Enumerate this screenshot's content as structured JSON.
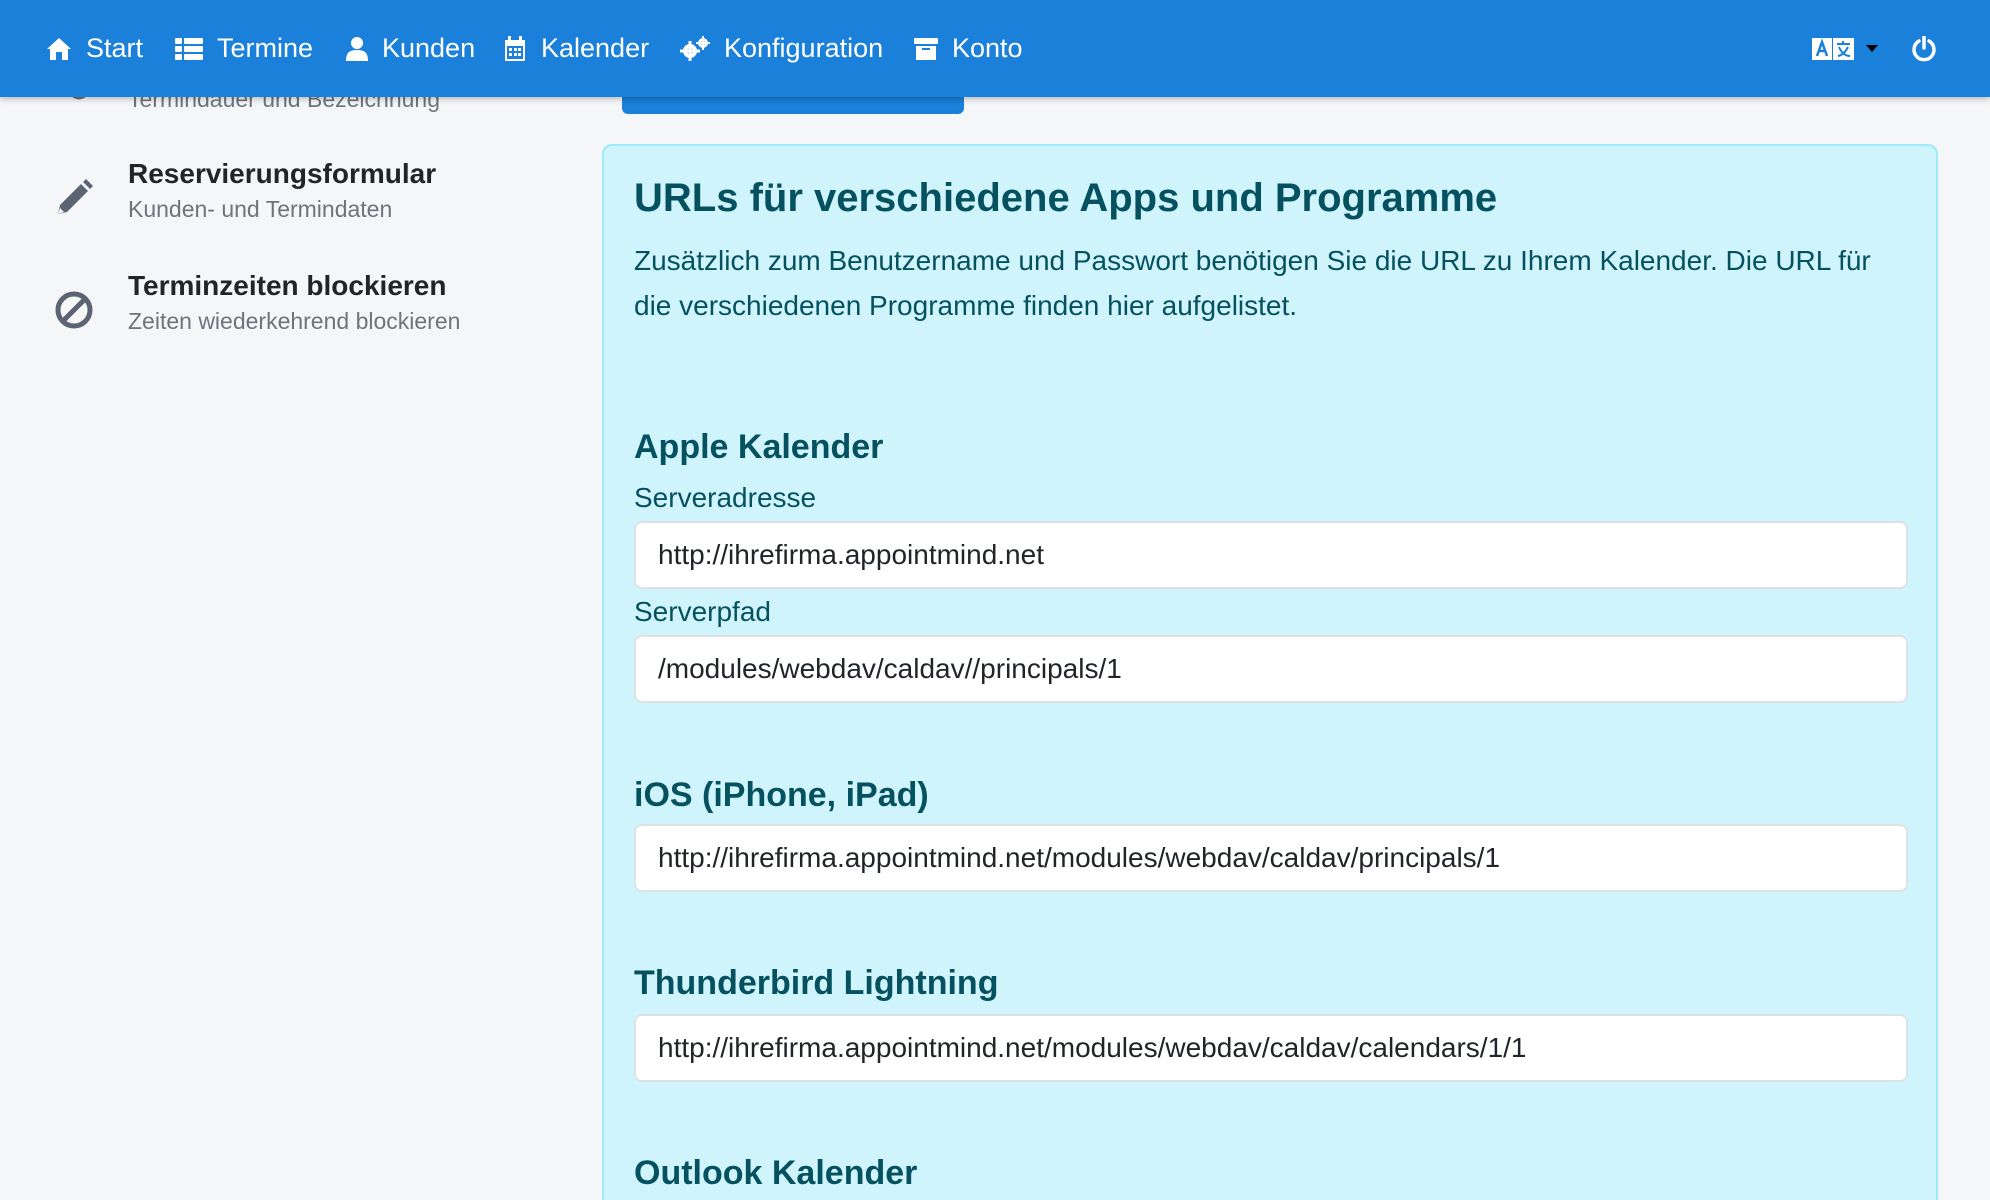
{
  "nav": {
    "items": [
      {
        "label": "Start",
        "icon": "home-icon"
      },
      {
        "label": "Termine",
        "icon": "list-icon"
      },
      {
        "label": "Kunden",
        "icon": "user-icon"
      },
      {
        "label": "Kalender",
        "icon": "calendar-icon"
      },
      {
        "label": "Konfiguration",
        "icon": "cogs-icon"
      },
      {
        "label": "Konto",
        "icon": "archive-icon"
      }
    ],
    "right_icons": [
      "language-icon",
      "power-icon"
    ],
    "color": "#1b80d9"
  },
  "sidebar": {
    "partial_sub": "Termindauer und Bezeichnung",
    "items": [
      {
        "title": "Reservierungsformular",
        "subtitle": "Kunden- und Termindaten",
        "icon": "pencil-icon"
      },
      {
        "title": "Terminzeiten blockieren",
        "subtitle": "Zeiten wiederkehrend blockieren",
        "icon": "ban-icon"
      }
    ]
  },
  "panel": {
    "title": "URLs für verschiedene Apps und Programme",
    "description": "Zusätzlich zum Benutzername und Passwort benötigen Sie die URL zu Ihrem Kalender. Die URL für die verschiedenen Programme finden hier aufgelistet.",
    "apple": {
      "title": "Apple Kalender",
      "server_label": "Serveradresse",
      "server_value": "http://ihrefirma.appointmind.net",
      "path_label": "Serverpfad",
      "path_value": "/modules/webdav/caldav//principals/1"
    },
    "ios": {
      "title": "iOS (iPhone, iPad)",
      "value": "http://ihrefirma.appointmind.net/modules/webdav/caldav/principals/1"
    },
    "thunderbird": {
      "title": "Thunderbird Lightning",
      "value": "http://ihrefirma.appointmind.net/modules/webdav/caldav/calendars/1/1"
    },
    "outlook": {
      "title": "Outlook Kalender"
    },
    "colors": {
      "background": "#cff4fc",
      "border": "#9eeaf9",
      "text": "#055160"
    }
  }
}
